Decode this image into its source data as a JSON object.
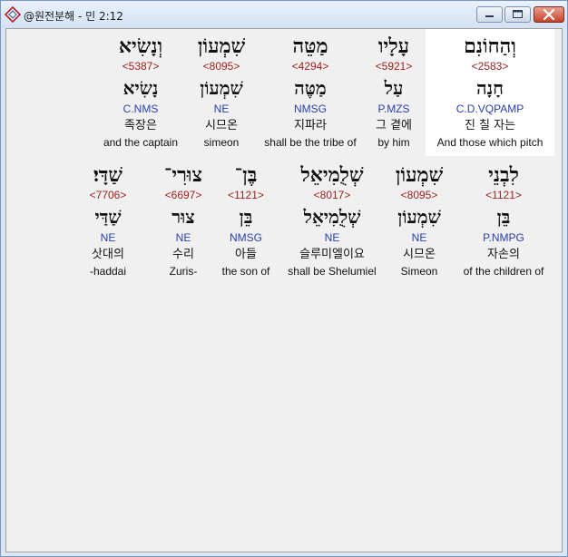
{
  "window": {
    "title": "@원전분해 - 민 2:12"
  },
  "icons": {
    "app": "app-diamond-icon",
    "minimize": "minimize-icon",
    "maximize": "maximize-icon",
    "close": "close-icon"
  },
  "row1": [
    {
      "heb": "וְהַחוֹנִם",
      "strong": "<2583>",
      "lemma": "חָנָה",
      "parse": "C.D.VQPAMP",
      "kor": "진 칠 자는",
      "eng": "And those which pitch"
    },
    {
      "heb": "עָלָיו",
      "strong": "<5921>",
      "lemma": "עַל",
      "parse": "P.MZS",
      "kor": "그 곁에",
      "eng": "by him"
    },
    {
      "heb": "מַטֵּה",
      "strong": "<4294>",
      "lemma": "מַטֶּה",
      "parse": "NMSG",
      "kor": "지파라",
      "eng": "shall be the tribe of"
    },
    {
      "heb": "שִׁמְעוֹן",
      "strong": "<8095>",
      "lemma": "שִׁמְעוֹן",
      "parse": "NE",
      "kor": "시므온",
      "eng": "simeon"
    },
    {
      "heb": "וְנָשִׂיא",
      "strong": "<5387>",
      "lemma": "נָשִׂיא",
      "parse": "C.NMS",
      "kor": "족장은",
      "eng": "and the captain"
    }
  ],
  "row2": [
    {
      "heb": "לִבְנֵי",
      "strong": "<1121>",
      "lemma": "בֵּן",
      "parse": "P.NMPG",
      "kor": "자손의",
      "eng": "of the children of"
    },
    {
      "heb": "שִׁמְעוֹן",
      "strong": "<8095>",
      "lemma": "שִׁמְעוֹן",
      "parse": "NE",
      "kor": "시므온",
      "eng": "Simeon"
    },
    {
      "heb": "שְׁלֻמִיאֵל",
      "strong": "<8017>",
      "lemma": "שְׁלֻמִיאֵל",
      "parse": "NE",
      "kor": "슬루미엘이요",
      "eng": "shall be Shelumiel"
    },
    {
      "heb": "בֶּן־",
      "strong": "<1121>",
      "lemma": "בֵּן",
      "parse": "NMSG",
      "kor": "아들",
      "eng": "the son of"
    },
    {
      "heb": "צוּרִי־",
      "strong": "<6697>",
      "lemma": "צוּר",
      "parse": "NE",
      "kor": "수리",
      "eng": "Zuris-"
    },
    {
      "heb": "שַׁדָּי׃",
      "strong": "<7706>",
      "lemma": "שַׁדַּי",
      "parse": "NE",
      "kor": "삿대의",
      "eng": "-haddai"
    }
  ]
}
